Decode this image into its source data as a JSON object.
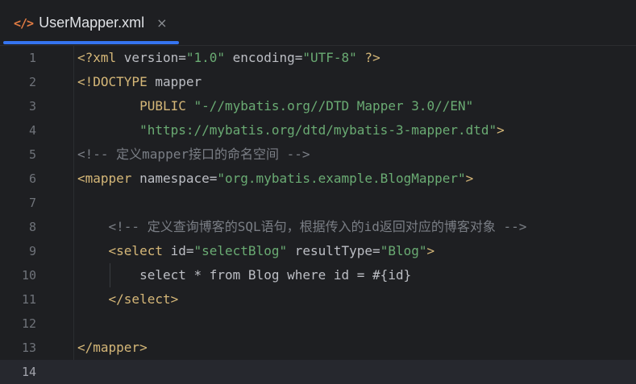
{
  "tab": {
    "icon": "</>",
    "title": "UserMapper.xml",
    "close": "×"
  },
  "colors": {
    "background": "#1e1f22",
    "tag": "#d5b778",
    "string": "#6aab73",
    "comment": "#7a7e85",
    "text": "#bcbec4",
    "line_number": "#6f737a",
    "accent": "#3574f0"
  },
  "icons": {
    "tab_icon": "xml-file-icon",
    "tab_close": "close-icon"
  },
  "current_line": 14,
  "lines": [
    {
      "n": "1",
      "tokens": [
        {
          "k": "tag",
          "t": "<?xml "
        },
        {
          "k": "attr",
          "t": "version="
        },
        {
          "k": "str",
          "t": "\"1.0\""
        },
        {
          "k": "attr",
          "t": " encoding="
        },
        {
          "k": "str",
          "t": "\"UTF-8\""
        },
        {
          "k": "tag",
          "t": " ?>"
        }
      ]
    },
    {
      "n": "2",
      "tokens": [
        {
          "k": "tag",
          "t": "<!DOCTYPE "
        },
        {
          "k": "text",
          "t": "mapper"
        }
      ]
    },
    {
      "n": "3",
      "tokens": [
        {
          "k": "text",
          "t": "        "
        },
        {
          "k": "tag",
          "t": "PUBLIC "
        },
        {
          "k": "str",
          "t": "\"-//mybatis.org//DTD Mapper 3.0//EN\""
        }
      ]
    },
    {
      "n": "4",
      "tokens": [
        {
          "k": "text",
          "t": "        "
        },
        {
          "k": "str",
          "t": "\"https://mybatis.org/dtd/mybatis-3-mapper.dtd\""
        },
        {
          "k": "tag",
          "t": ">"
        }
      ]
    },
    {
      "n": "5",
      "tokens": [
        {
          "k": "com",
          "t": "<!-- 定义mapper接口的命名空间 -->"
        }
      ]
    },
    {
      "n": "6",
      "tokens": [
        {
          "k": "tag",
          "t": "<mapper "
        },
        {
          "k": "attr",
          "t": "namespace="
        },
        {
          "k": "str",
          "t": "\"org.mybatis.example.BlogMapper\""
        },
        {
          "k": "tag",
          "t": ">"
        }
      ]
    },
    {
      "n": "7",
      "tokens": []
    },
    {
      "n": "8",
      "tokens": [
        {
          "k": "text",
          "t": "    "
        },
        {
          "k": "com",
          "t": "<!-- 定义查询博客的SQL语句，根据传入的id返回对应的博客对象 -->"
        }
      ]
    },
    {
      "n": "9",
      "tokens": [
        {
          "k": "text",
          "t": "    "
        },
        {
          "k": "tag",
          "t": "<select "
        },
        {
          "k": "attr",
          "t": "id="
        },
        {
          "k": "str",
          "t": "\"selectBlog\""
        },
        {
          "k": "attr",
          "t": " resultType="
        },
        {
          "k": "str",
          "t": "\"Blog\""
        },
        {
          "k": "tag",
          "t": ">"
        }
      ]
    },
    {
      "n": "10",
      "guide": true,
      "tokens": [
        {
          "k": "text",
          "t": "        select * from Blog where id = #{id}"
        }
      ]
    },
    {
      "n": "11",
      "tokens": [
        {
          "k": "text",
          "t": "    "
        },
        {
          "k": "tag",
          "t": "</select>"
        }
      ]
    },
    {
      "n": "12",
      "tokens": []
    },
    {
      "n": "13",
      "tokens": [
        {
          "k": "tag",
          "t": "</mapper>"
        }
      ]
    },
    {
      "n": "14",
      "tokens": []
    }
  ]
}
